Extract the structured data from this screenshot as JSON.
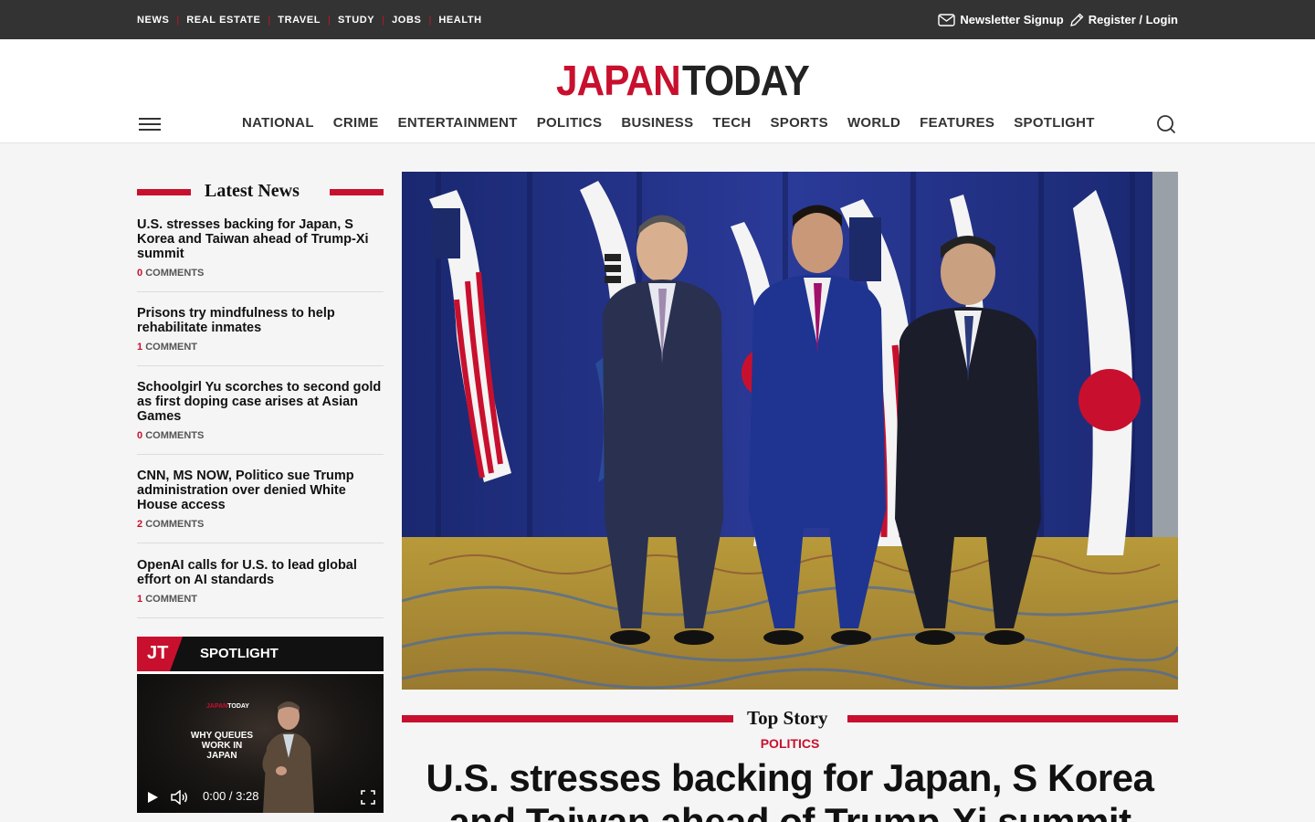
{
  "topbar": {
    "sections": [
      "NEWS",
      "REAL ESTATE",
      "TRAVEL",
      "STUDY",
      "JOBS",
      "HEALTH"
    ],
    "newsletter_label": "Newsletter Signup",
    "login_label": "Register / Login"
  },
  "header": {
    "logo_part1": "JAPAN",
    "logo_part2": "TODAY",
    "nav": [
      "NATIONAL",
      "CRIME",
      "ENTERTAINMENT",
      "POLITICS",
      "BUSINESS",
      "TECH",
      "SPORTS",
      "WORLD",
      "FEATURES",
      "SPOTLIGHT"
    ]
  },
  "sidebar": {
    "latest_title": "Latest News",
    "items": [
      {
        "headline": "U.S. stresses backing for Japan, S Korea and Taiwan ahead of Trump-Xi summit",
        "count": "0",
        "label": "COMMENTS"
      },
      {
        "headline": "Prisons try mindfulness to help rehabilitate inmates",
        "count": "1",
        "label": "COMMENT"
      },
      {
        "headline": "Schoolgirl Yu scorches to second gold as first doping case arises at Asian Games",
        "count": "0",
        "label": "COMMENTS"
      },
      {
        "headline": "CNN, MS NOW, Politico sue Trump administration over denied White House access",
        "count": "2",
        "label": "COMMENTS"
      },
      {
        "headline": "OpenAI calls for U.S. to lead global effort on AI standards",
        "count": "1",
        "label": "COMMENT"
      }
    ],
    "spotlight": {
      "logo": "JT",
      "label": "SPOTLIGHT",
      "video_logo_a": "JAPAN",
      "video_logo_b": "TODAY",
      "video_title": "WHY QUEUES WORK IN JAPAN",
      "time": "0:00 / 3:28"
    }
  },
  "main": {
    "section_title": "Top Story",
    "category": "POLITICS",
    "headline": "U.S. stresses backing for Japan, S Korea and Taiwan ahead of Trump-Xi summit"
  },
  "colors": {
    "brand_red": "#c8102e",
    "topbar_bg": "#333333"
  }
}
